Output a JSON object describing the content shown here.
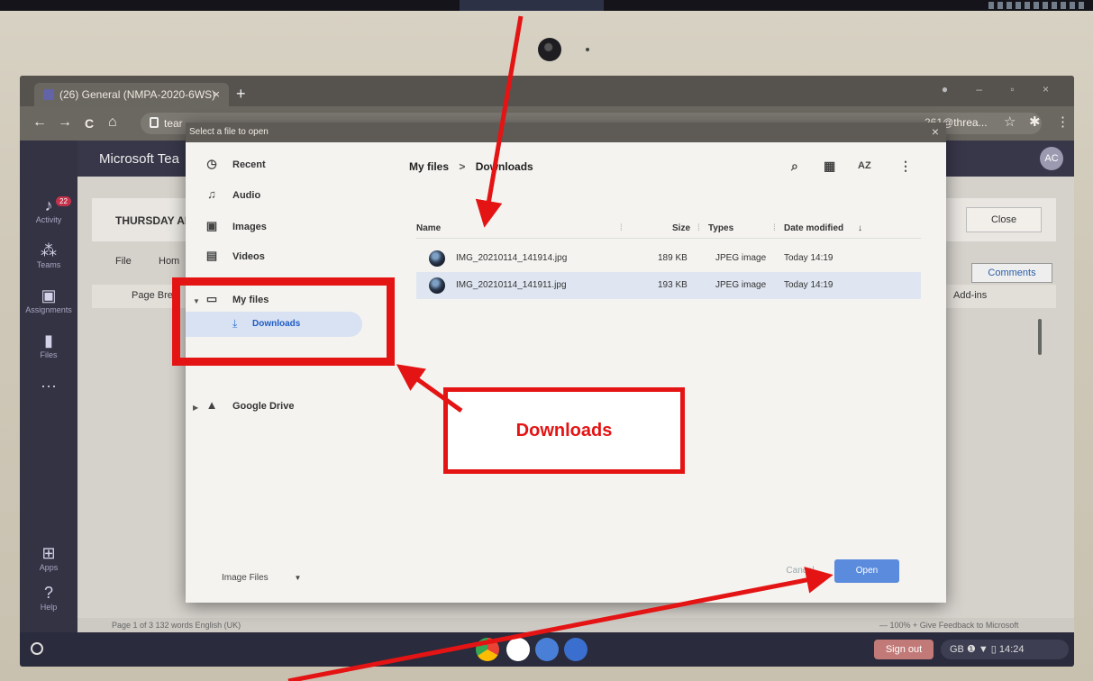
{
  "browser": {
    "tab_title": "(26) General (NMPA-2020-6WS)",
    "tab_close": "×",
    "new_tab": "+",
    "back": "←",
    "forward": "→",
    "reload": "C",
    "home": "⌂",
    "url": "tear",
    "account": "261@threa..."
  },
  "teams": {
    "app_title": "Microsoft Tea",
    "avatar": "AC",
    "activity_badge": "22",
    "rail": [
      "Activity",
      "Teams",
      "Assignments",
      "Files",
      "Apps",
      "Help"
    ],
    "banner": "THURSDAY AI",
    "close_label": "Close",
    "menu": [
      "File",
      "Hom"
    ],
    "comments_label": "Comments",
    "ribbon_left": "Page Bre",
    "ribbon_right": "Add-ins",
    "status_left": "Page 1 of 3    132 words    English (UK)",
    "status_right": "—    100%    +    Give Feedback to Microsoft"
  },
  "dialog": {
    "title": "Select a file to open",
    "sidebar": {
      "recent": "Recent",
      "audio": "Audio",
      "images": "Images",
      "videos": "Videos",
      "my_files": "My files",
      "downloads": "Downloads",
      "google_drive": "Google Drive"
    },
    "breadcrumb": {
      "root": "My files",
      "separator": ">",
      "current": "Downloads"
    },
    "columns": {
      "name": "Name",
      "size": "Size",
      "type": "Types",
      "date": "Date modified"
    },
    "files": [
      {
        "name": "IMG_20210114_141914.jpg",
        "size": "189 KB",
        "type": "JPEG image",
        "date": "Today 14:19"
      },
      {
        "name": "IMG_20210114_141911.jpg",
        "size": "193 KB",
        "type": "JPEG image",
        "date": "Today 14:19"
      }
    ],
    "filter": "Image Files",
    "cancel": "Cancel",
    "open": "Open"
  },
  "shelf": {
    "sign_out": "Sign out",
    "tray": "GB  ❶  ▼  ▯  14:24"
  },
  "annotation": {
    "callout": "Downloads"
  }
}
